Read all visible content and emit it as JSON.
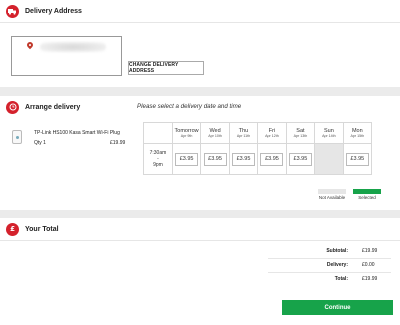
{
  "address": {
    "icon": "truck-icon",
    "title": "Delivery Address",
    "change_label": "CHANGE DELIVERY ADDRESS"
  },
  "arrange": {
    "icon": "clock-icon",
    "title": "Arrange delivery",
    "subtitle": "Please select a delivery date and time",
    "product": {
      "name": "TP-Link HS100 Kasa Smart Wi-Fi Plug",
      "qty": "Qty 1",
      "price": "£19.99"
    },
    "calendar": {
      "days": [
        {
          "name": "Tomorrow",
          "date": "Apr 9th"
        },
        {
          "name": "Wed",
          "date": "Apr 10th"
        },
        {
          "name": "Thu",
          "date": "Apr 11th"
        },
        {
          "name": "Fri",
          "date": "Apr 12th"
        },
        {
          "name": "Sat",
          "date": "Apr 13th"
        },
        {
          "name": "Sun",
          "date": "Apr 14th"
        },
        {
          "name": "Mon",
          "date": "Apr 15th"
        }
      ],
      "time_slot": "7:30am\n-\n9pm",
      "slots": [
        "£3.95",
        "£3.95",
        "£3.95",
        "£3.95",
        "£3.95",
        "",
        "£3.95"
      ]
    },
    "legend": {
      "not_available": "Not Available",
      "selected": "Selected",
      "not_available_color": "#e6e6e6",
      "selected_color": "#17a34a"
    }
  },
  "total": {
    "icon": "pound-icon",
    "title": "Your Total",
    "subtotal_label": "Subtotal:",
    "subtotal_value": "£19.99",
    "delivery_label": "Delivery:",
    "delivery_value": "£0.00",
    "total_label": "Total:",
    "total_value": "£19.99",
    "continue_label": "Continue"
  },
  "colors": {
    "accent_red": "#d4212c",
    "accent_green": "#17a34a"
  }
}
